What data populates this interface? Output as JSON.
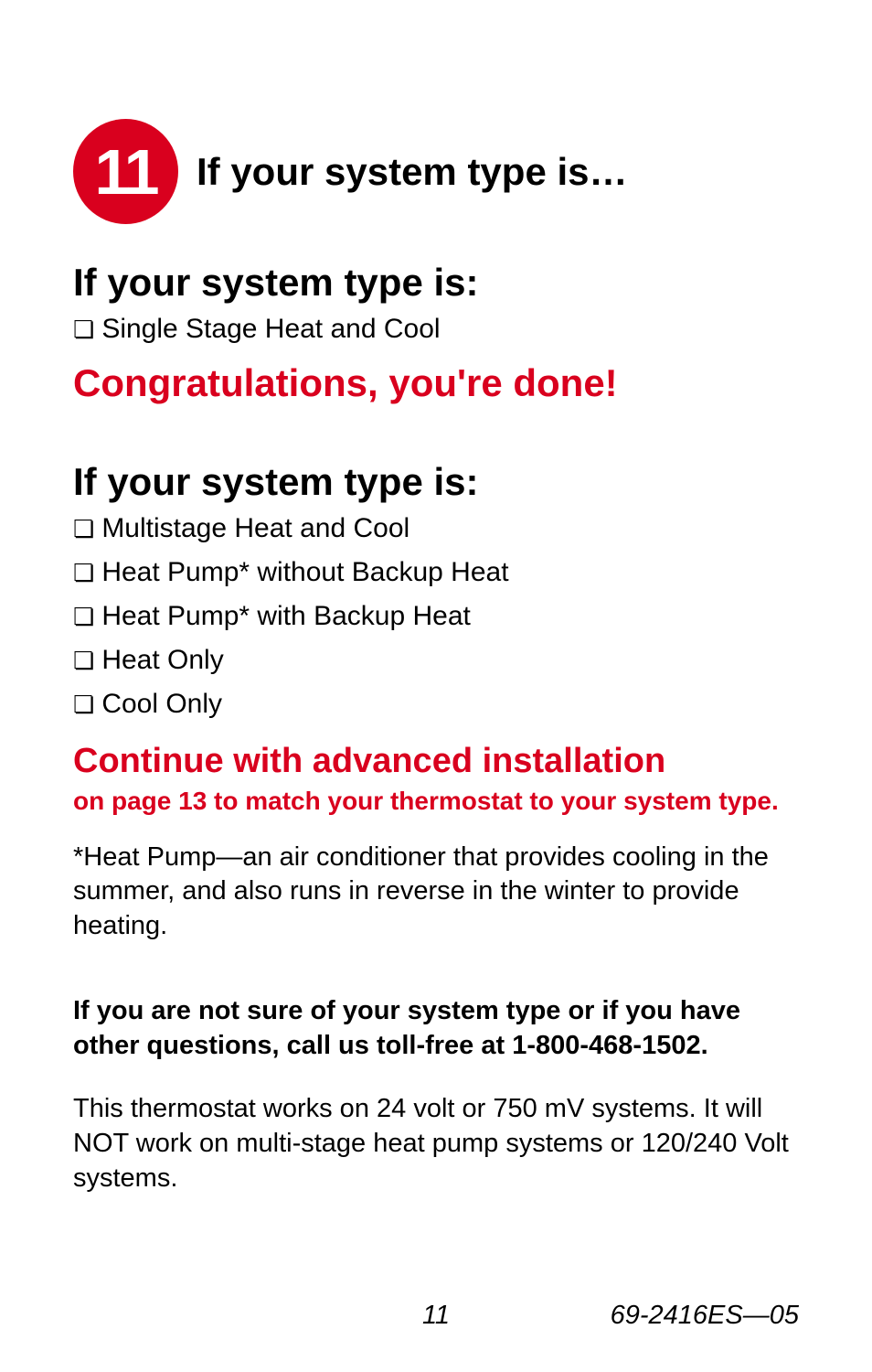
{
  "step": {
    "number": "11",
    "title": "If your system type is…"
  },
  "section1": {
    "heading": "If your system type is:",
    "items": [
      "Single Stage Heat and Cool"
    ],
    "done": "Congratulations, you're done!"
  },
  "section2": {
    "heading": "If your system type is:",
    "items": [
      "Multistage Heat and Cool",
      "Heat Pump* without Backup Heat",
      "Heat Pump* with Backup Heat",
      "Heat Only",
      "Cool Only"
    ]
  },
  "continue": {
    "main": "Continue with advanced installation",
    "sub": "on page 13 to match your thermostat to your system type."
  },
  "footnote": "*Heat Pump—an air conditioner that provides cooling in the summer, and also runs in reverse in the winter to provide heating.",
  "help": "If you are not sure of your system type or if you have other questions, call us toll-free at 1-800-468-1502.",
  "compat": "This thermostat works on 24 volt or 750 mV systems. It will NOT work on multi-stage heat pump systems or 120/240 Volt systems.",
  "footer": {
    "page": "11",
    "code": "69-2416ES—05"
  },
  "checkbox_glyph": "❏"
}
